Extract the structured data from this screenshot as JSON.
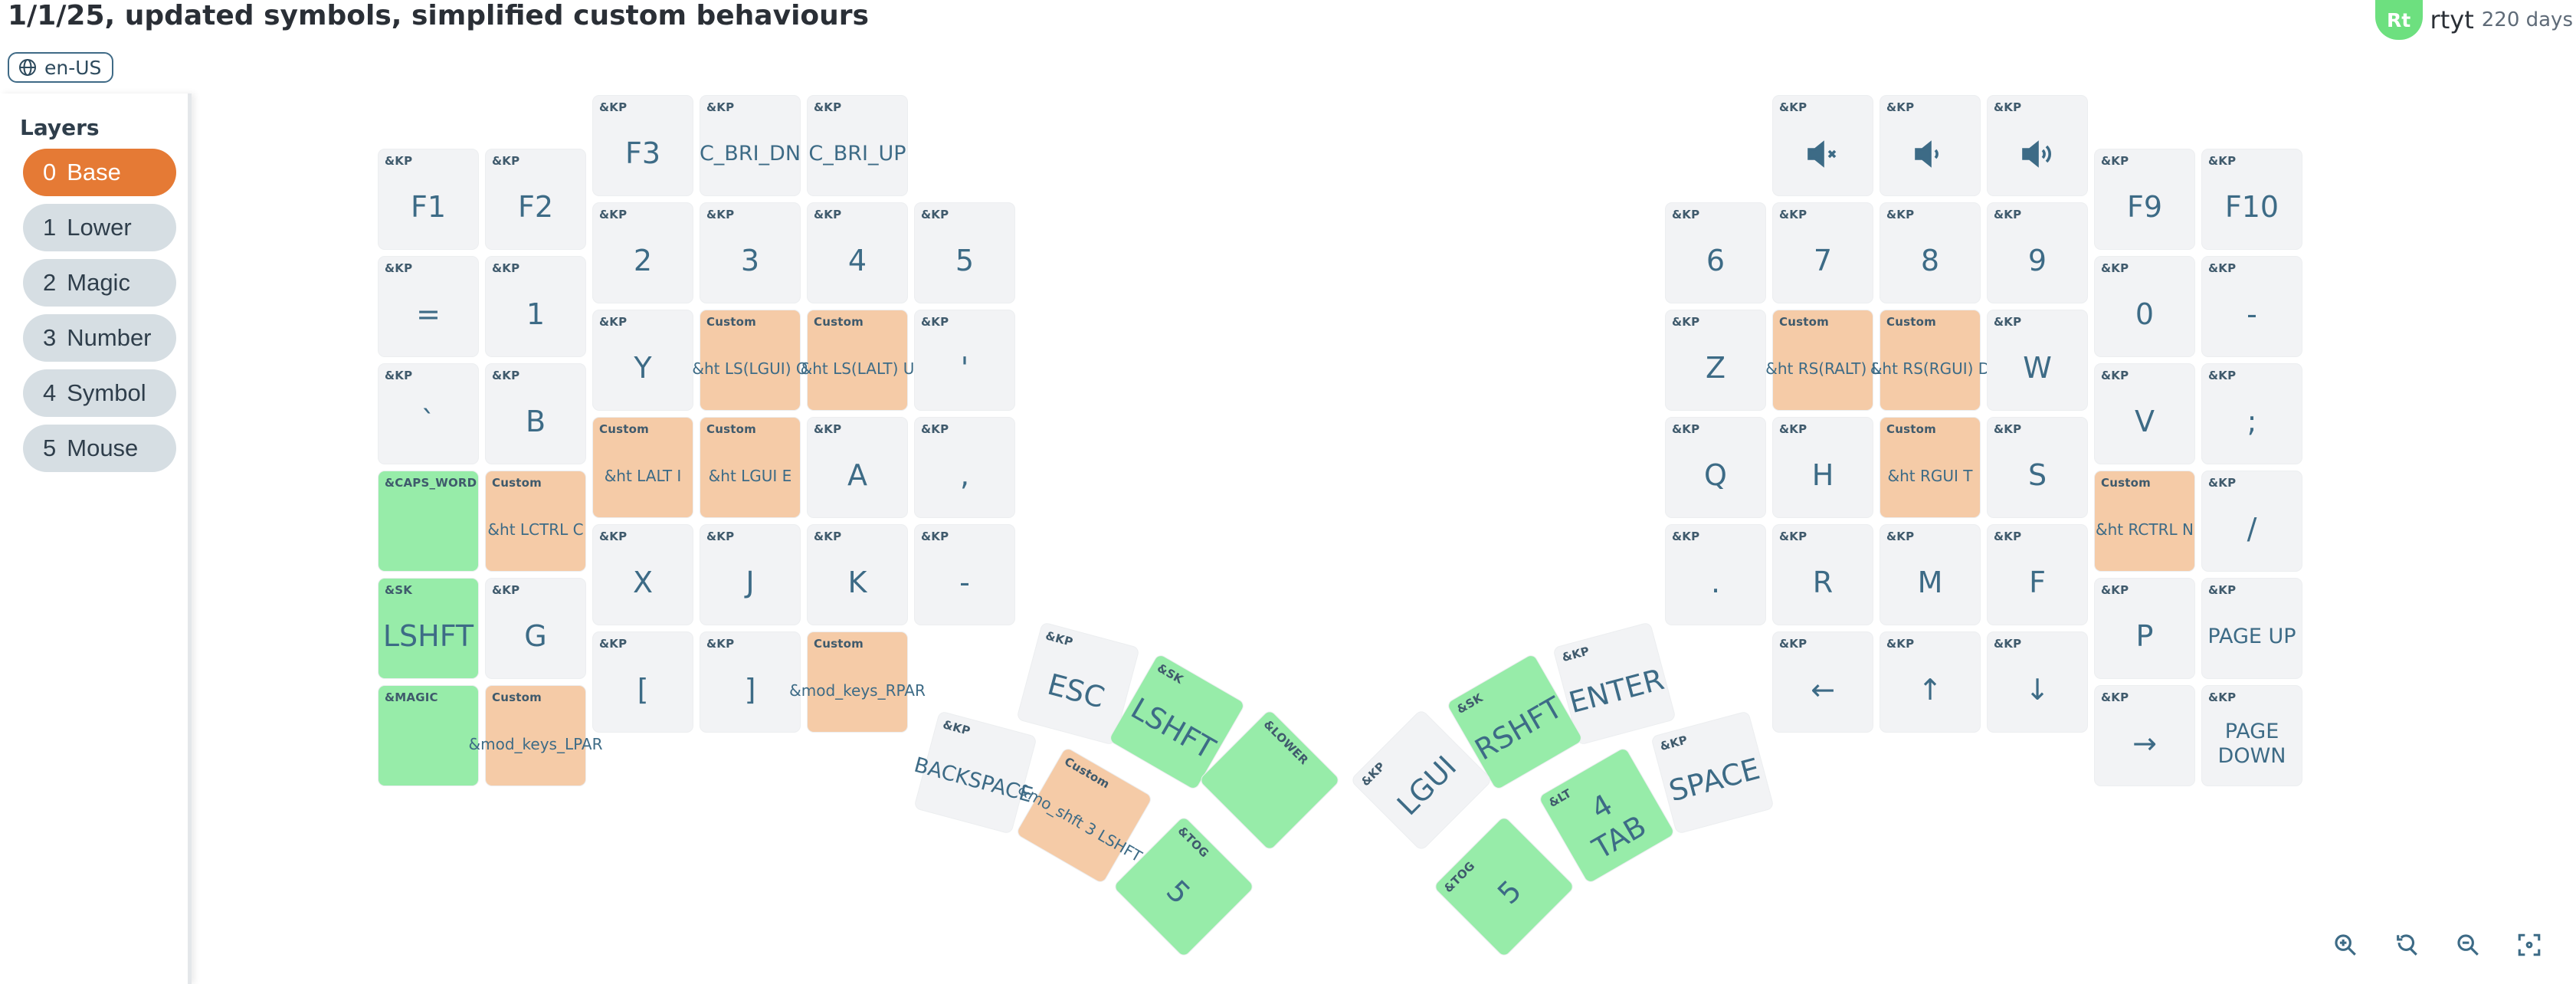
{
  "header": {
    "title": "1/1/25, updated symbols, simplified custom behaviours"
  },
  "locale": {
    "label": "en-US",
    "icon": "globe-icon"
  },
  "user": {
    "initials": "Rt",
    "name": "rtyt",
    "age": "220 days",
    "avatar_color": "#6de07f"
  },
  "sidebar": {
    "title": "Layers",
    "layers": [
      {
        "num": "0",
        "name": "Base",
        "active": true
      },
      {
        "num": "1",
        "name": "Lower"
      },
      {
        "num": "2",
        "name": "Magic"
      },
      {
        "num": "3",
        "name": "Number"
      },
      {
        "num": "4",
        "name": "Symbol"
      },
      {
        "num": "5",
        "name": "Mouse"
      }
    ]
  },
  "colors": {
    "active_layer": "#e57a35",
    "custom_key": "#f5cba7",
    "special_key": "#97eca9",
    "plain_key": "#f2f3f5",
    "label_text": "#3d6b86"
  },
  "keys": [
    {
      "id": "l-f1",
      "type": "&KP",
      "label": "F1"
    },
    {
      "id": "l-f2",
      "type": "&KP",
      "label": "F2"
    },
    {
      "id": "l-f3",
      "type": "&KP",
      "label": "F3"
    },
    {
      "id": "l-bri-dn",
      "type": "&KP",
      "label": "C_BRI_DN"
    },
    {
      "id": "l-bri-up",
      "type": "&KP",
      "label": "C_BRI_UP"
    },
    {
      "id": "l-eq",
      "type": "&KP",
      "label": "="
    },
    {
      "id": "l-1",
      "type": "&KP",
      "label": "1"
    },
    {
      "id": "l-2",
      "type": "&KP",
      "label": "2"
    },
    {
      "id": "l-3",
      "type": "&KP",
      "label": "3"
    },
    {
      "id": "l-4",
      "type": "&KP",
      "label": "4"
    },
    {
      "id": "l-5",
      "type": "&KP",
      "label": "5"
    },
    {
      "id": "l-grave",
      "type": "&KP",
      "label": "`"
    },
    {
      "id": "l-b",
      "type": "&KP",
      "label": "B"
    },
    {
      "id": "l-y",
      "type": "&KP",
      "label": "Y"
    },
    {
      "id": "l-ht-o",
      "type": "Custom",
      "label": "&ht LS(LGUI) O"
    },
    {
      "id": "l-ht-u",
      "type": "Custom",
      "label": "&ht LS(LALT) U"
    },
    {
      "id": "l-quote",
      "type": "&KP",
      "label": "'"
    },
    {
      "id": "l-capsword",
      "type": "&CAPS_WORD",
      "label": ""
    },
    {
      "id": "l-ht-c",
      "type": "Custom",
      "label": "&ht LCTRL C"
    },
    {
      "id": "l-ht-i",
      "type": "Custom",
      "label": "&ht LALT I"
    },
    {
      "id": "l-ht-e",
      "type": "Custom",
      "label": "&ht LGUI E"
    },
    {
      "id": "l-a",
      "type": "&KP",
      "label": "A"
    },
    {
      "id": "l-comma",
      "type": "&KP",
      "label": ","
    },
    {
      "id": "l-sk-lshft",
      "type": "&SK",
      "label": "LSHFT"
    },
    {
      "id": "l-g",
      "type": "&KP",
      "label": "G"
    },
    {
      "id": "l-x",
      "type": "&KP",
      "label": "X"
    },
    {
      "id": "l-j",
      "type": "&KP",
      "label": "J"
    },
    {
      "id": "l-k",
      "type": "&KP",
      "label": "K"
    },
    {
      "id": "l-minus",
      "type": "&KP",
      "label": "-"
    },
    {
      "id": "l-magic",
      "type": "&MAGIC",
      "label": ""
    },
    {
      "id": "l-lpar",
      "type": "Custom",
      "label": "&mod_keys_LPAR"
    },
    {
      "id": "l-lbkt",
      "type": "&KP",
      "label": "["
    },
    {
      "id": "l-rbkt",
      "type": "&KP",
      "label": "]"
    },
    {
      "id": "l-rpar",
      "type": "Custom",
      "label": "&mod_keys_RPAR"
    },
    {
      "id": "l-esc",
      "type": "&KP",
      "label": "ESC"
    },
    {
      "id": "l-th-lshft",
      "type": "&SK",
      "label": "LSHFT"
    },
    {
      "id": "l-lower",
      "type": "&LOWER",
      "label": ""
    },
    {
      "id": "l-bspc",
      "type": "&KP",
      "label": "BACKSPACE"
    },
    {
      "id": "l-mo-shft",
      "type": "Custom",
      "label": "&mo_shft 3 LSHFT"
    },
    {
      "id": "l-tog5",
      "type": "&TOG",
      "label": "5"
    },
    {
      "id": "r-mute",
      "type": "&KP",
      "label": "",
      "icon": "volume-mute-icon"
    },
    {
      "id": "r-voldn",
      "type": "&KP",
      "label": "",
      "icon": "volume-down-icon"
    },
    {
      "id": "r-volup",
      "type": "&KP",
      "label": "",
      "icon": "volume-up-icon"
    },
    {
      "id": "r-f9",
      "type": "&KP",
      "label": "F9"
    },
    {
      "id": "r-f10",
      "type": "&KP",
      "label": "F10"
    },
    {
      "id": "r-6",
      "type": "&KP",
      "label": "6"
    },
    {
      "id": "r-7",
      "type": "&KP",
      "label": "7"
    },
    {
      "id": "r-8",
      "type": "&KP",
      "label": "8"
    },
    {
      "id": "r-9",
      "type": "&KP",
      "label": "9"
    },
    {
      "id": "r-0",
      "type": "&KP",
      "label": "0"
    },
    {
      "id": "r-minus",
      "type": "&KP",
      "label": "-"
    },
    {
      "id": "r-z",
      "type": "&KP",
      "label": "Z"
    },
    {
      "id": "r-ht-l",
      "type": "Custom",
      "label": "&ht RS(RALT) L"
    },
    {
      "id": "r-ht-d",
      "type": "Custom",
      "label": "&ht RS(RGUI) D"
    },
    {
      "id": "r-w",
      "type": "&KP",
      "label": "W"
    },
    {
      "id": "r-v",
      "type": "&KP",
      "label": "V"
    },
    {
      "id": "r-semi",
      "type": "&KP",
      "label": ";"
    },
    {
      "id": "r-q",
      "type": "&KP",
      "label": "Q"
    },
    {
      "id": "r-h",
      "type": "&KP",
      "label": "H"
    },
    {
      "id": "r-ht-t",
      "type": "Custom",
      "label": "&ht RGUI T"
    },
    {
      "id": "r-s",
      "type": "&KP",
      "label": "S"
    },
    {
      "id": "r-ht-n",
      "type": "Custom",
      "label": "&ht RCTRL N"
    },
    {
      "id": "r-slash",
      "type": "&KP",
      "label": "/"
    },
    {
      "id": "r-dot",
      "type": "&KP",
      "label": "."
    },
    {
      "id": "r-r",
      "type": "&KP",
      "label": "R"
    },
    {
      "id": "r-m",
      "type": "&KP",
      "label": "M"
    },
    {
      "id": "r-f",
      "type": "&KP",
      "label": "F"
    },
    {
      "id": "r-p",
      "type": "&KP",
      "label": "P"
    },
    {
      "id": "r-pgup",
      "type": "&KP",
      "label": "PAGE UP"
    },
    {
      "id": "r-left",
      "type": "&KP",
      "label": "←"
    },
    {
      "id": "r-up",
      "type": "&KP",
      "label": "↑"
    },
    {
      "id": "r-down",
      "type": "&KP",
      "label": "↓"
    },
    {
      "id": "r-right",
      "type": "&KP",
      "label": "→"
    },
    {
      "id": "r-pgdn",
      "type": "&KP",
      "label": "PAGE DOWN"
    },
    {
      "id": "r-enter",
      "type": "&KP",
      "label": "ENTER"
    },
    {
      "id": "r-sk-rshft",
      "type": "&SK",
      "label": "RSHFT"
    },
    {
      "id": "r-lgui",
      "type": "&KP",
      "label": "LGUI"
    },
    {
      "id": "r-space",
      "type": "&KP",
      "label": "SPACE"
    },
    {
      "id": "r-lt-tab",
      "type": "&LT",
      "label": "4\nTAB"
    },
    {
      "id": "r-tog5",
      "type": "&TOG",
      "label": "5"
    }
  ],
  "zoom": {
    "icons": [
      "zoom-in-icon",
      "zoom-reset-icon",
      "zoom-out-icon",
      "fit-screen-icon"
    ]
  }
}
